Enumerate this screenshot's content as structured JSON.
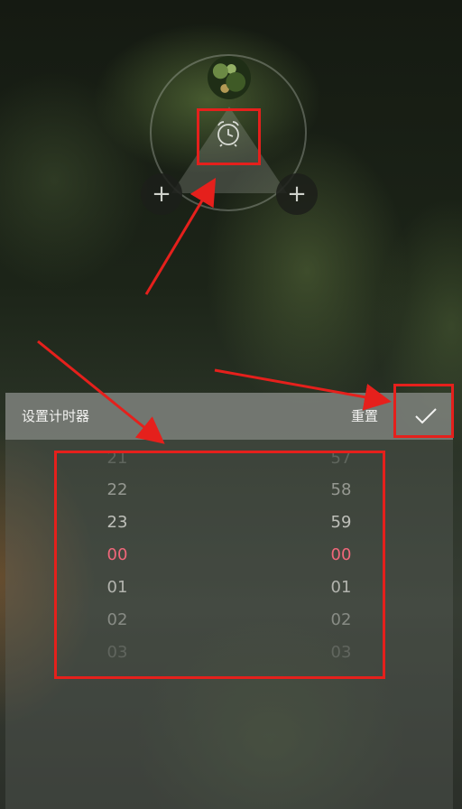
{
  "timer_panel": {
    "title": "设置计时器",
    "reset_label": "重置",
    "confirm_icon": "check-icon"
  },
  "picker": {
    "hours": [
      "21",
      "22",
      "23",
      "00",
      "01",
      "02",
      "03"
    ],
    "minutes": [
      "57",
      "58",
      "59",
      "00",
      "01",
      "02",
      "03"
    ],
    "selected_hour": "00",
    "selected_minute": "00"
  },
  "controls": {
    "left_add_icon": "plus-icon",
    "right_add_icon": "plus-icon",
    "center_icon": "alarm-clock-icon"
  },
  "colors": {
    "selected_value": "#f0677a",
    "annotation": "#e5201c"
  }
}
